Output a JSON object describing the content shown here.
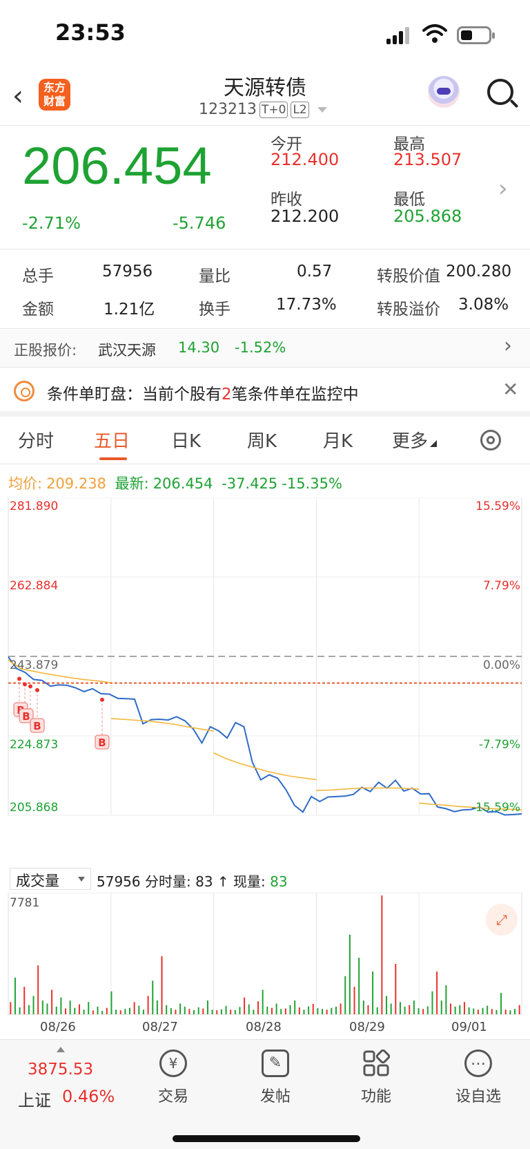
{
  "status_bar": {
    "time": "23:53"
  },
  "nav": {
    "logo_line1": "东方",
    "logo_line2": "财富",
    "title": "天源转债",
    "code": "123213",
    "tag1": "T+0",
    "tag2": "L2"
  },
  "quote": {
    "price": "206.454",
    "change_pct": "-2.71%",
    "change_amt": "-5.746",
    "open_label": "今开",
    "open": "212.400",
    "high_label": "最高",
    "high": "213.507",
    "prev_close_label": "昨收",
    "prev_close": "212.200",
    "low_label": "最低",
    "low": "205.868"
  },
  "stats": {
    "volume_label": "总手",
    "volume": "57956",
    "vol_ratio_label": "量比",
    "vol_ratio": "0.57",
    "conv_value_label": "转股价值",
    "conv_value": "200.280",
    "amount_label": "金额",
    "amount": "1.21亿",
    "turnover_label": "换手",
    "turnover": "17.73%",
    "premium_label": "转股溢价",
    "premium": "3.08%"
  },
  "underlying": {
    "label": "正股报价:",
    "name": "武汉天源",
    "price": "14.30",
    "change": "-1.52%"
  },
  "banner": {
    "text_before": "条件单盯盘：当前个股有",
    "count": "2",
    "text_after": "笔条件单在监控中"
  },
  "tabs": [
    {
      "label": "分时"
    },
    {
      "label": "五日"
    },
    {
      "label": "日K"
    },
    {
      "label": "周K"
    },
    {
      "label": "月K"
    },
    {
      "label": "更多"
    }
  ],
  "info": {
    "avg_label": "均价:",
    "avg": "209.238",
    "latest_label": "最新:",
    "latest": "206.454",
    "chg": "-37.425",
    "chg_pct": "-15.35%"
  },
  "chart_data": {
    "type": "line",
    "title": "",
    "y_labels_left": [
      "281.890",
      "262.884",
      "243.879",
      "224.873",
      "205.868"
    ],
    "y_labels_right": [
      "15.59%",
      "7.79%",
      "0.00%",
      "-7.79%",
      "-15.59%"
    ],
    "ylim": [
      205.868,
      281.89
    ],
    "reference_price": 243.879,
    "cost_line": 237.5,
    "days": [
      "08/26",
      "08/27",
      "08/28",
      "08/29",
      "09/01"
    ],
    "series": [
      {
        "values": [
          243.5,
          241.2,
          239.8,
          238.6,
          237.9,
          237.0,
          236.8,
          237.2,
          236.1,
          235.7,
          235.9,
          235.2,
          234.6,
          234.1,
          233.5,
          233.9,
          227.5,
          229.0,
          228.6,
          228.9,
          229.2,
          228.7,
          226.2,
          223.4,
          226.8,
          226.3,
          224.1,
          228.3,
          226.8,
          218.8,
          214.1,
          215.8,
          214.5,
          212.2,
          208.0,
          206.9,
          210.1,
          209.4,
          210.0,
          210.6,
          210.2,
          211.1,
          212.3,
          211.8,
          213.5,
          212.6,
          214.0,
          211.9,
          212.1,
          211.2,
          210.8,
          208.1,
          207.2,
          207.0,
          206.9,
          207.5,
          207.6,
          206.9,
          206.5,
          206.2,
          205.8,
          206.454
        ]
      },
      {
        "values": [
          243.0,
          240.9,
          240.3,
          239.7,
          239.2,
          238.7,
          238.3,
          238.0,
          237.6,
          229.0,
          228.8,
          228.6,
          228.4,
          228.0,
          227.6,
          227.0,
          226.5,
          226.0,
          220.8,
          219.4,
          218.3,
          217.4,
          216.5,
          215.8,
          215.2,
          214.8,
          214.4,
          211.8,
          211.9,
          212.1,
          212.3,
          212.4,
          212.4,
          212.4,
          212.3,
          212.1,
          208.8,
          208.5,
          208.3,
          208.0,
          207.8,
          207.6,
          207.4,
          207.3,
          207.2
        ]
      }
    ],
    "markers": [
      "B",
      "B",
      "B",
      "B"
    ]
  },
  "volume": {
    "select_label": "成交量",
    "total": "57956",
    "bar_label": "分时量:",
    "bar_value": "83",
    "now_label": "现量:",
    "now_value": "83",
    "max_label": "7781",
    "ylim": [
      0,
      7781
    ],
    "bars": [
      800,
      2400,
      450,
      1800,
      600,
      1200,
      3200,
      900,
      700,
      1600,
      500,
      1100,
      380,
      900,
      420,
      650,
      300,
      800,
      250,
      500,
      220,
      420,
      1500,
      300,
      260,
      350,
      420,
      800,
      560,
      300,
      1200,
      2200,
      900,
      3800,
      600,
      400,
      300,
      700,
      500,
      350,
      280,
      450,
      380,
      900,
      300,
      260,
      320,
      540,
      300,
      280,
      480,
      1100,
      650,
      300,
      850,
      1600,
      500,
      420,
      700,
      350,
      380,
      600,
      900,
      450,
      300,
      520,
      680,
      400,
      350,
      300,
      420,
      500,
      700,
      2500,
      5200,
      1800,
      3700,
      900,
      600,
      2800,
      450,
      7781,
      1200,
      700,
      3300,
      800,
      500,
      600,
      900,
      400,
      350,
      520,
      1500,
      2800,
      900,
      1900,
      700,
      500,
      600,
      800,
      450,
      380,
      300,
      420,
      560,
      350,
      280,
      1400,
      300,
      260,
      350,
      600
    ],
    "bar_colors": [
      "#e8312c",
      "#1fa233"
    ]
  },
  "dates": [
    "08/26",
    "08/27",
    "08/28",
    "08/29",
    "09/01"
  ],
  "bottom": {
    "index_value": "3875.53",
    "index_name": "上证",
    "index_pct": "0.46%",
    "trade": "交易",
    "post": "发帖",
    "function": "功能",
    "watchlist": "设自选"
  },
  "colors": {
    "up": "#e8312c",
    "down": "#1fa233",
    "accent": "#e8592c",
    "price_line": "#2d6bc9",
    "avg_line": "#f5b63a"
  }
}
